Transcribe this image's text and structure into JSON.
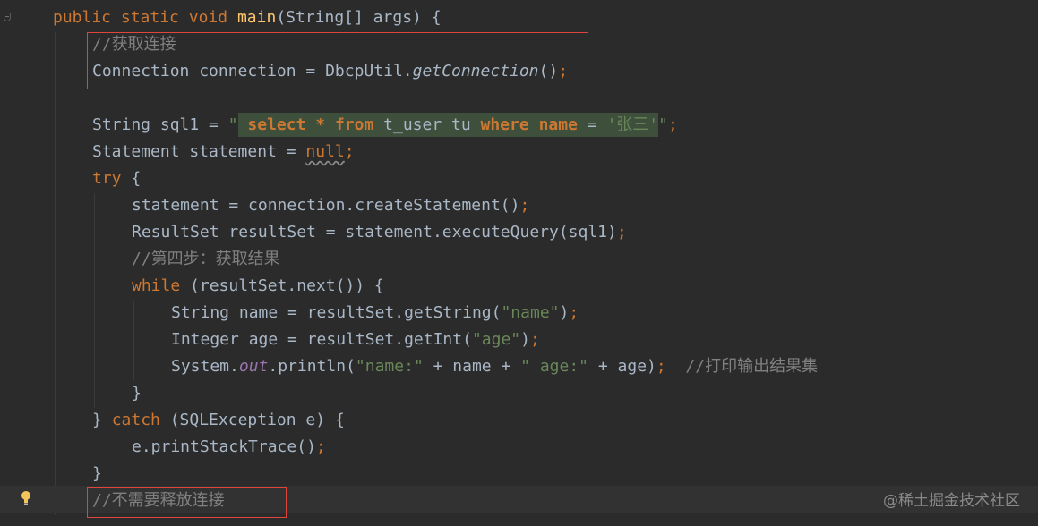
{
  "code": {
    "l1": {
      "kw1": "public",
      "kw2": "static",
      "kw3": "void",
      "method": "main",
      "rest": "(String[] args) {"
    },
    "l2": {
      "comment": "//获取连接"
    },
    "l3": {
      "pre": "Connection connection = DbcpUtil.",
      "call": "getConnection",
      "post": "()",
      "semi": ";"
    },
    "l5": {
      "pre": "String sql1 = ",
      "q1": "\"",
      "sp": " ",
      "s_select": "select",
      "s_star": " * ",
      "s_from": "from",
      "s_table": " t_user tu ",
      "s_where": "where",
      "s_sp": " ",
      "s_name": "name",
      "s_eq": " = ",
      "s_val": "'张三'",
      "q2": "\"",
      "semi": ";"
    },
    "l6": {
      "pre": "Statement statement = ",
      "null_kw": "null",
      "semi": ";"
    },
    "l7": {
      "kw": "try",
      "rest": " {"
    },
    "l8": {
      "text": "statement = connection.createStatement()",
      "semi": ";"
    },
    "l9": {
      "text": "ResultSet resultSet = statement.executeQuery(sql1)",
      "semi": ";"
    },
    "l10": {
      "comment": "//第四步：获取结果"
    },
    "l11": {
      "kw": "while",
      "rest": " (resultSet.next()) {"
    },
    "l12": {
      "pre": "String name = resultSet.getString(",
      "str": "\"name\"",
      "post": ")",
      "semi": ";"
    },
    "l13": {
      "pre": "Integer age = resultSet.getInt(",
      "str": "\"age\"",
      "post": ")",
      "semi": ";"
    },
    "l14": {
      "pre": "System.",
      "field": "out",
      "mid": ".println(",
      "str1": "\"name:\"",
      "mid2": " + name + ",
      "str2": "\" age:\"",
      "post": " + age)",
      "semi": ";",
      "comment": "  //打印输出结果集"
    },
    "l15": {
      "text": "}"
    },
    "l16": {
      "pre": "} ",
      "kw": "catch",
      "rest": " (SQLException e) {"
    },
    "l17": {
      "text": "e.printStackTrace()",
      "semi": ";"
    },
    "l18": {
      "text": "}"
    },
    "l19": {
      "comment": "//不需要释放连接"
    }
  },
  "watermark": "@稀土掘金技术社区",
  "icons": {
    "fold": "fold-marker-icon",
    "intention": "lightbulb-icon"
  },
  "colors": {
    "background": "#2b2b2b",
    "keyword": "#cc7832",
    "method_decl": "#ffc66d",
    "string": "#6a8759",
    "comment": "#808080",
    "annotation_box": "#e0443e",
    "sql_injection_bg": "#3e4f3c"
  }
}
